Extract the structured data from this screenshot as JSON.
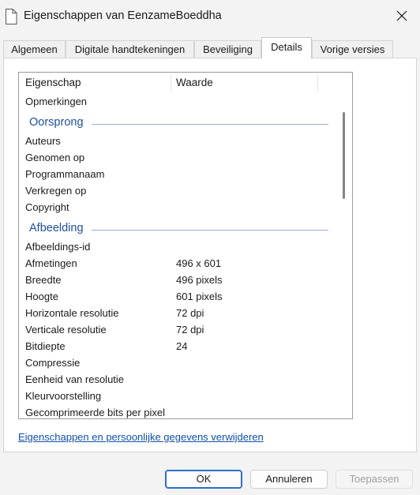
{
  "window": {
    "title": "Eigenschappen van EenzameBoeddha"
  },
  "tabs": [
    {
      "label": "Algemeen"
    },
    {
      "label": "Digitale handtekeningen"
    },
    {
      "label": "Beveiliging"
    },
    {
      "label": "Details"
    },
    {
      "label": "Vorige versies"
    }
  ],
  "active_tab": "Details",
  "columns": {
    "property": "Eigenschap",
    "value": "Waarde"
  },
  "rows": {
    "opmerkingen": {
      "key": "Opmerkingen",
      "value": ""
    },
    "auteurs": {
      "key": "Auteurs",
      "value": ""
    },
    "genomen_op": {
      "key": "Genomen op",
      "value": ""
    },
    "programmanaam": {
      "key": "Programmanaam",
      "value": ""
    },
    "verkregen_op": {
      "key": "Verkregen op",
      "value": ""
    },
    "copyright": {
      "key": "Copyright",
      "value": ""
    },
    "afbeeldings_id": {
      "key": "Afbeeldings-id",
      "value": ""
    },
    "afmetingen": {
      "key": "Afmetingen",
      "value": "496 x 601"
    },
    "breedte": {
      "key": "Breedte",
      "value": "496 pixels"
    },
    "hoogte": {
      "key": "Hoogte",
      "value": "601 pixels"
    },
    "hor_res": {
      "key": "Horizontale resolutie",
      "value": "72 dpi"
    },
    "vert_res": {
      "key": "Verticale resolutie",
      "value": "72 dpi"
    },
    "bitdiepte": {
      "key": "Bitdiepte",
      "value": "24"
    },
    "compressie": {
      "key": "Compressie",
      "value": ""
    },
    "eenheid": {
      "key": "Eenheid van resolutie",
      "value": ""
    },
    "kleur": {
      "key": "Kleurvoorstelling",
      "value": ""
    },
    "gecomprimeerd": {
      "key": "Gecomprimeerde bits per pixel",
      "value": ""
    }
  },
  "groups": {
    "oorsprong": "Oorsprong",
    "afbeelding": "Afbeelding"
  },
  "remove_link": "Eigenschappen en persoonlijke gegevens verwijderen",
  "buttons": {
    "ok": "OK",
    "cancel": "Annuleren",
    "apply": "Toepassen"
  }
}
